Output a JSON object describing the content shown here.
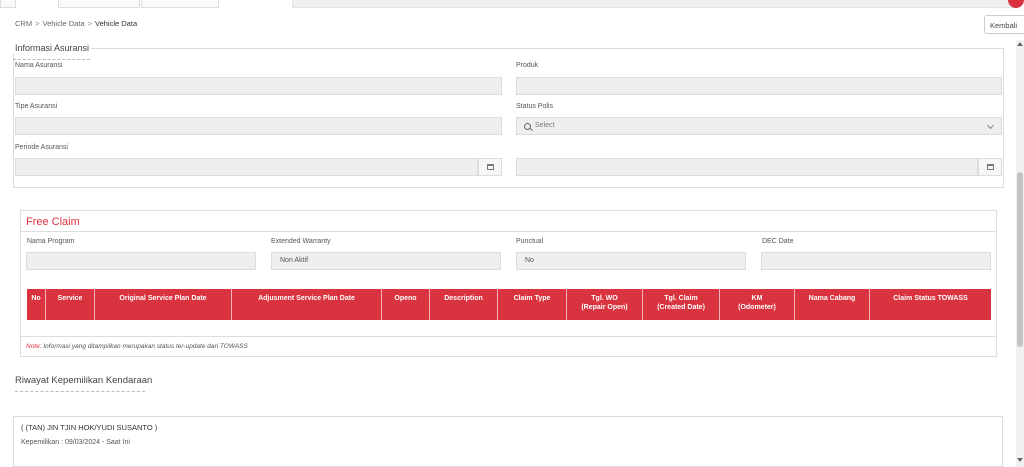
{
  "breadcrumb": [
    "CRM",
    "Vehicle Data",
    "Vehicle Data"
  ],
  "breadcrumb_sep": ">",
  "back_button": "Kembali",
  "insurance": {
    "legend": "Informasi Asuransi",
    "nama_label": "Nama Asuransi",
    "produk_label": "Produk",
    "tipe_label": "Tipe Asuransi",
    "status_label": "Status Polis",
    "status_placeholder": "Select",
    "periode_label": "Periode Asuransi"
  },
  "free_claim": {
    "title": "Free Claim",
    "nama_program_label": "Nama Program",
    "extended_warranty_label": "Extended Warranty",
    "extended_warranty_value": "Non Aktif",
    "punctual_label": "Punctual",
    "punctual_value": "No",
    "dec_date_label": "DEC Date",
    "columns": [
      "No",
      "Service",
      "Original Service Plan Date",
      "Adjusment Service Plan Date",
      "Openo",
      "Description",
      "Claim Type",
      "Tgl. WO\n(Repair Open)",
      "Tgl. Claim\n(Created Date)",
      "KM\n(Odometer)",
      "Nama Cabang",
      "Claim Status TOWASS"
    ],
    "note_prefix": "Note:",
    "note_text": " Informasi yang ditampilkan merupakan status ter-update dari TOWASS"
  },
  "ownership": {
    "title": "Riwayat Kepemilikan Kendaraan",
    "owner_name": "( (TAN) JIN TJIN HOK/YUDI SUSANTO )",
    "owner_period": "Kepemilikan : 09/03/2024 - Saat Ini"
  },
  "colors": {
    "accent": "#d9333f",
    "field_bg": "#efefef",
    "border": "#dddddd"
  },
  "icons": [
    "calendar-icon",
    "search-icon",
    "chevron-down-icon"
  ]
}
